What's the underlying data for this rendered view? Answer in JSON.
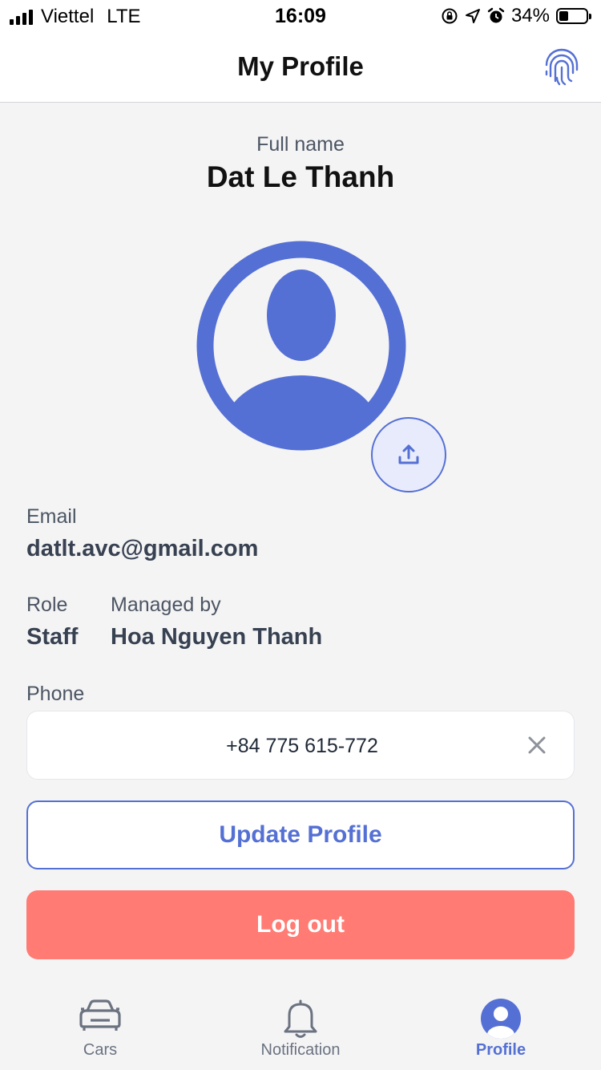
{
  "status_bar": {
    "carrier": "Viettel",
    "network": "LTE",
    "time": "16:09",
    "battery": "34%",
    "battery_level": 0.34
  },
  "nav": {
    "title": "My Profile",
    "right_icon": "fingerprint-icon"
  },
  "profile": {
    "full_name_label": "Full name",
    "full_name": "Dat Le Thanh",
    "email_label": "Email",
    "email": "datlt.avc@gmail.com",
    "role_label": "Role",
    "role": "Staff",
    "managed_by_label": "Managed by",
    "managed_by": "Hoa Nguyen Thanh",
    "phone_label": "Phone",
    "phone": "+84 775 615-772"
  },
  "actions": {
    "update_label": "Update Profile",
    "logout_label": "Log out"
  },
  "tabs": [
    {
      "label": "Cars",
      "icon": "car-icon",
      "active": false
    },
    {
      "label": "Notification",
      "icon": "bell-icon",
      "active": false
    },
    {
      "label": "Profile",
      "icon": "profile-icon",
      "active": true
    }
  ],
  "colors": {
    "accent": "#5570d4",
    "logout": "#ff7b73",
    "background": "#f4f4f5"
  }
}
